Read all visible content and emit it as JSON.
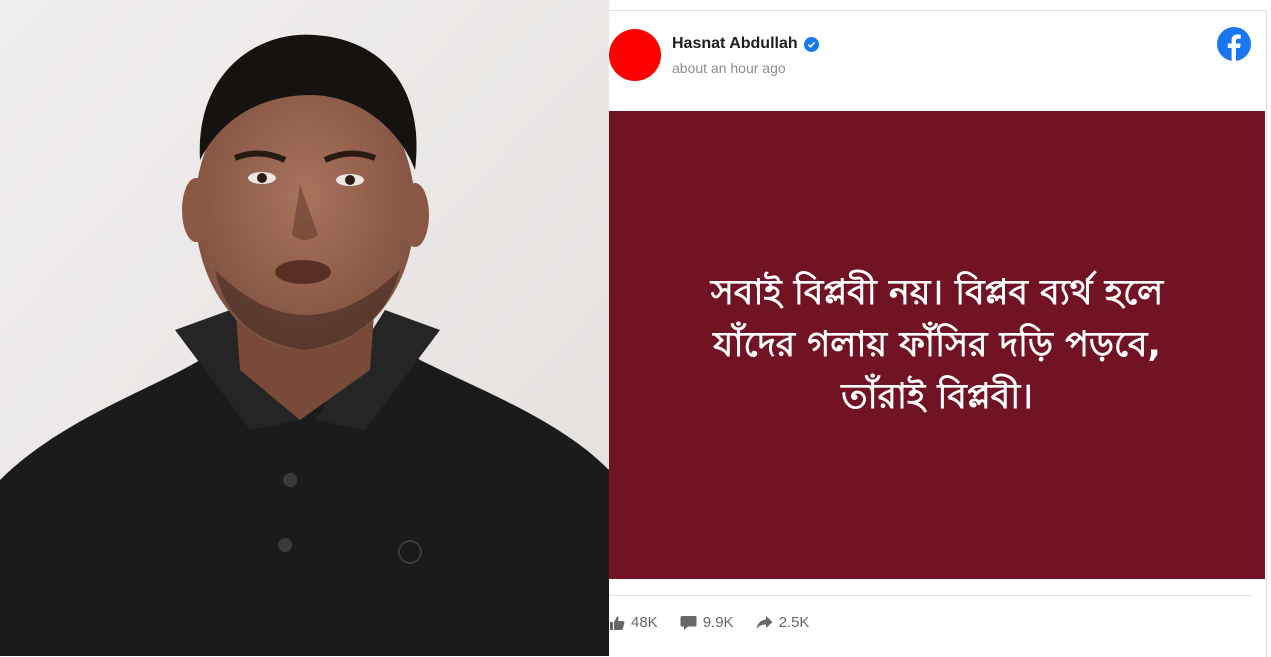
{
  "post": {
    "author": "Hasnat Abdullah",
    "timestamp": "about an hour ago",
    "text": "সবাই বিপ্লবী নয়। বিপ্লব ব্যর্থ হলে যাঁদের গলায় ফাঁসির দড়ি পড়বে, তাঁরাই বিপ্লবী।",
    "background_color": "#721324",
    "avatar_color": "#ff0000",
    "verified_icon": "verified-badge-icon",
    "platform_icon": "facebook-icon"
  },
  "stats": {
    "likes": "48K",
    "comments": "9.9K",
    "shares": "2.5K"
  },
  "colors": {
    "facebook_blue": "#1877f2",
    "shirt": "#1a1a1a"
  }
}
